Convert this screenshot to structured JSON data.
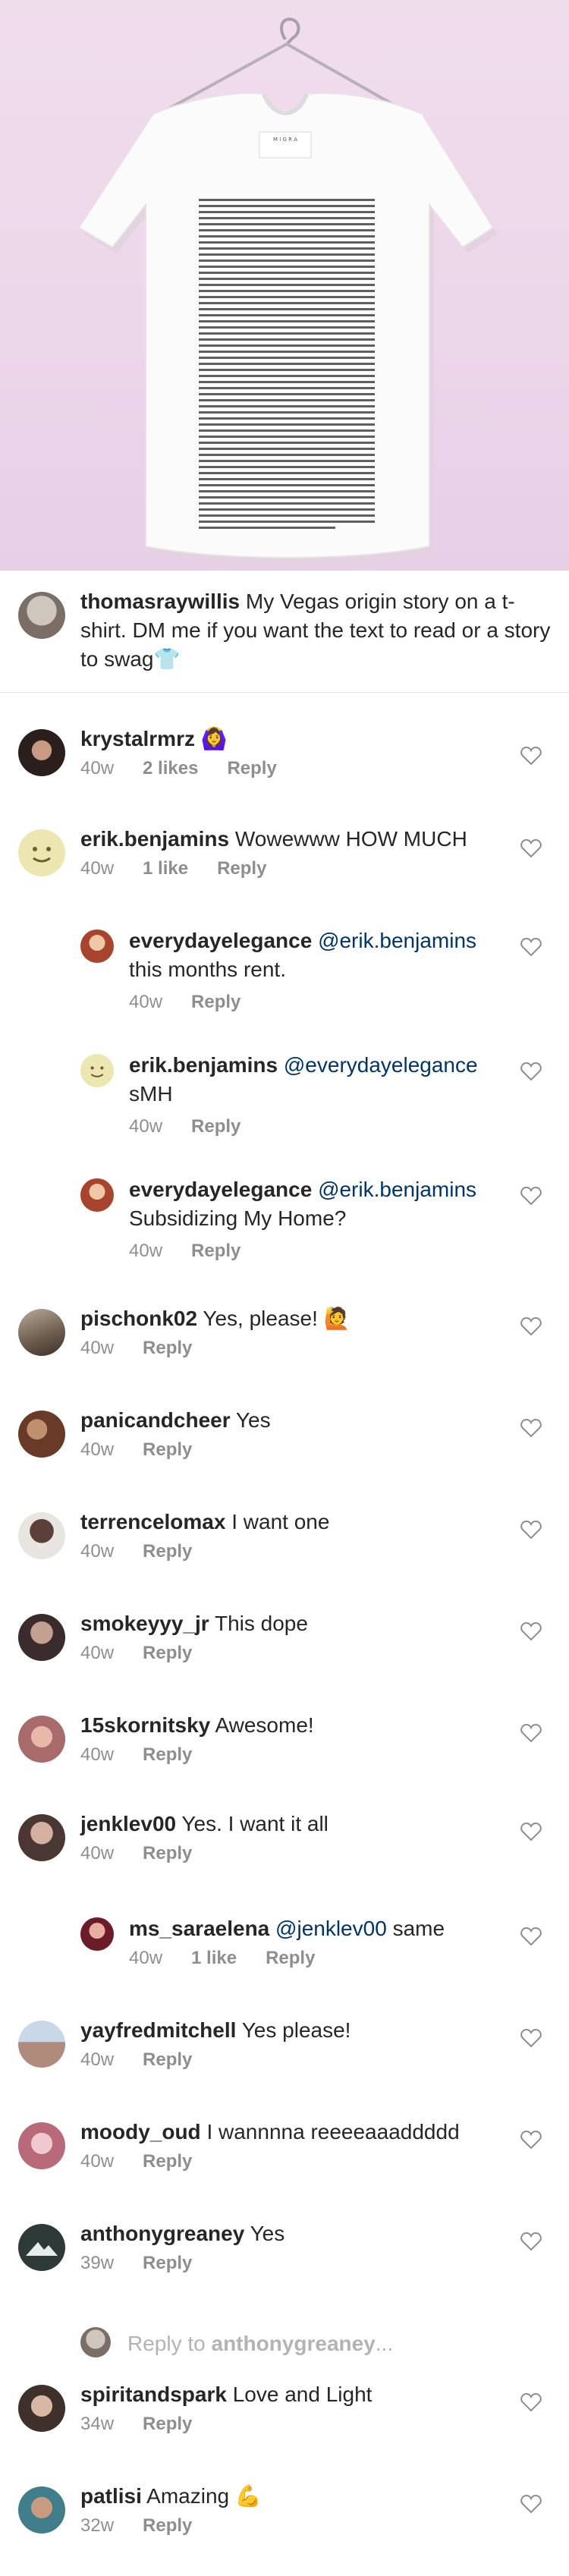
{
  "post": {
    "caption_user": "thomasraywillis",
    "caption_text": "My Vegas origin story on a t-shirt. DM me if you want the text to read or a story to swag",
    "caption_emoji": "👕",
    "shirt_label": "M I G R A"
  },
  "comments": [
    {
      "user": "krystalrmrz",
      "text": "",
      "emoji": "🙆‍♀️",
      "time": "40w",
      "likes": "2 likes",
      "reply": "Reply",
      "avatar_color": "#3a2e2a"
    },
    {
      "user": "erik.benjamins",
      "text": "Wowewww HOW MUCH",
      "emoji": "",
      "time": "40w",
      "likes": "1 like",
      "reply": "Reply",
      "avatar_color": "#e9e2a8"
    },
    {
      "user": "everydayelegance",
      "mention": "@erik.benjamins",
      "text": "this months rent.",
      "time": "40w",
      "likes": "",
      "reply": "Reply",
      "avatar_color": "#b6523c",
      "is_reply": true
    },
    {
      "user": "erik.benjamins",
      "mention": "@everydayelegance",
      "text": "sMH",
      "time": "40w",
      "likes": "",
      "reply": "Reply",
      "avatar_color": "#e9e2a8",
      "is_reply": true
    },
    {
      "user": "everydayelegance",
      "mention": "@erik.benjamins",
      "text": "Subsidizing My Home?",
      "time": "40w",
      "likes": "",
      "reply": "Reply",
      "avatar_color": "#b6523c",
      "is_reply": true
    },
    {
      "user": "pischonk02",
      "text": "Yes, please!",
      "emoji": "🙋",
      "time": "40w",
      "likes": "",
      "reply": "Reply",
      "avatar_color": "#6b5a4c"
    },
    {
      "user": "panicandcheer",
      "text": "Yes",
      "emoji": "",
      "time": "40w",
      "likes": "",
      "reply": "Reply",
      "avatar_color": "#7a4a36"
    },
    {
      "user": "terrencelomax",
      "text": "I want one",
      "emoji": "",
      "time": "40w",
      "likes": "",
      "reply": "Reply",
      "avatar_color": "#3b2e2a"
    },
    {
      "user": "smokeyyy_jr",
      "text": "This dope",
      "emoji": "",
      "time": "40w",
      "likes": "",
      "reply": "Reply",
      "avatar_color": "#4a3a3a"
    },
    {
      "user": "15skornitsky",
      "text": "Awesome!",
      "emoji": "",
      "time": "40w",
      "likes": "",
      "reply": "Reply",
      "avatar_color": "#c98a7a"
    },
    {
      "user": "jenklev00",
      "text": "Yes. I want it all",
      "emoji": "",
      "time": "40w",
      "likes": "",
      "reply": "Reply",
      "avatar_color": "#5c4a44"
    },
    {
      "user": "ms_saraelena",
      "mention": "@jenklev00",
      "text": "same",
      "time": "40w",
      "likes": "1 like",
      "reply": "Reply",
      "avatar_color": "#7c2430",
      "is_reply": true
    },
    {
      "user": "yayfredmitchell",
      "text": "Yes please!",
      "emoji": "",
      "time": "40w",
      "likes": "",
      "reply": "Reply",
      "avatar_color": "#b08a7a"
    },
    {
      "user": "moody_oud",
      "text": "I wannnna reeeeaaaddddd",
      "emoji": "",
      "time": "40w",
      "likes": "",
      "reply": "Reply",
      "avatar_color": "#c07a86"
    },
    {
      "user": "anthonygreaney",
      "text": "Yes",
      "emoji": "",
      "time": "39w",
      "likes": "",
      "reply": "Reply",
      "avatar_color": "#2e3a38"
    },
    {
      "user": "spiritandspark",
      "text": "Love and Light",
      "emoji": "",
      "time": "34w",
      "likes": "",
      "reply": "Reply",
      "avatar_color": "#4a3c36"
    },
    {
      "user": "patlisi",
      "text": "Amazing",
      "emoji": "💪",
      "time": "32w",
      "likes": "",
      "reply": "Reply",
      "avatar_color": "#3f7e8a"
    }
  ],
  "reply_to": {
    "prefix": "Reply to",
    "user": "anthonygreaney",
    "suffix": "..."
  }
}
